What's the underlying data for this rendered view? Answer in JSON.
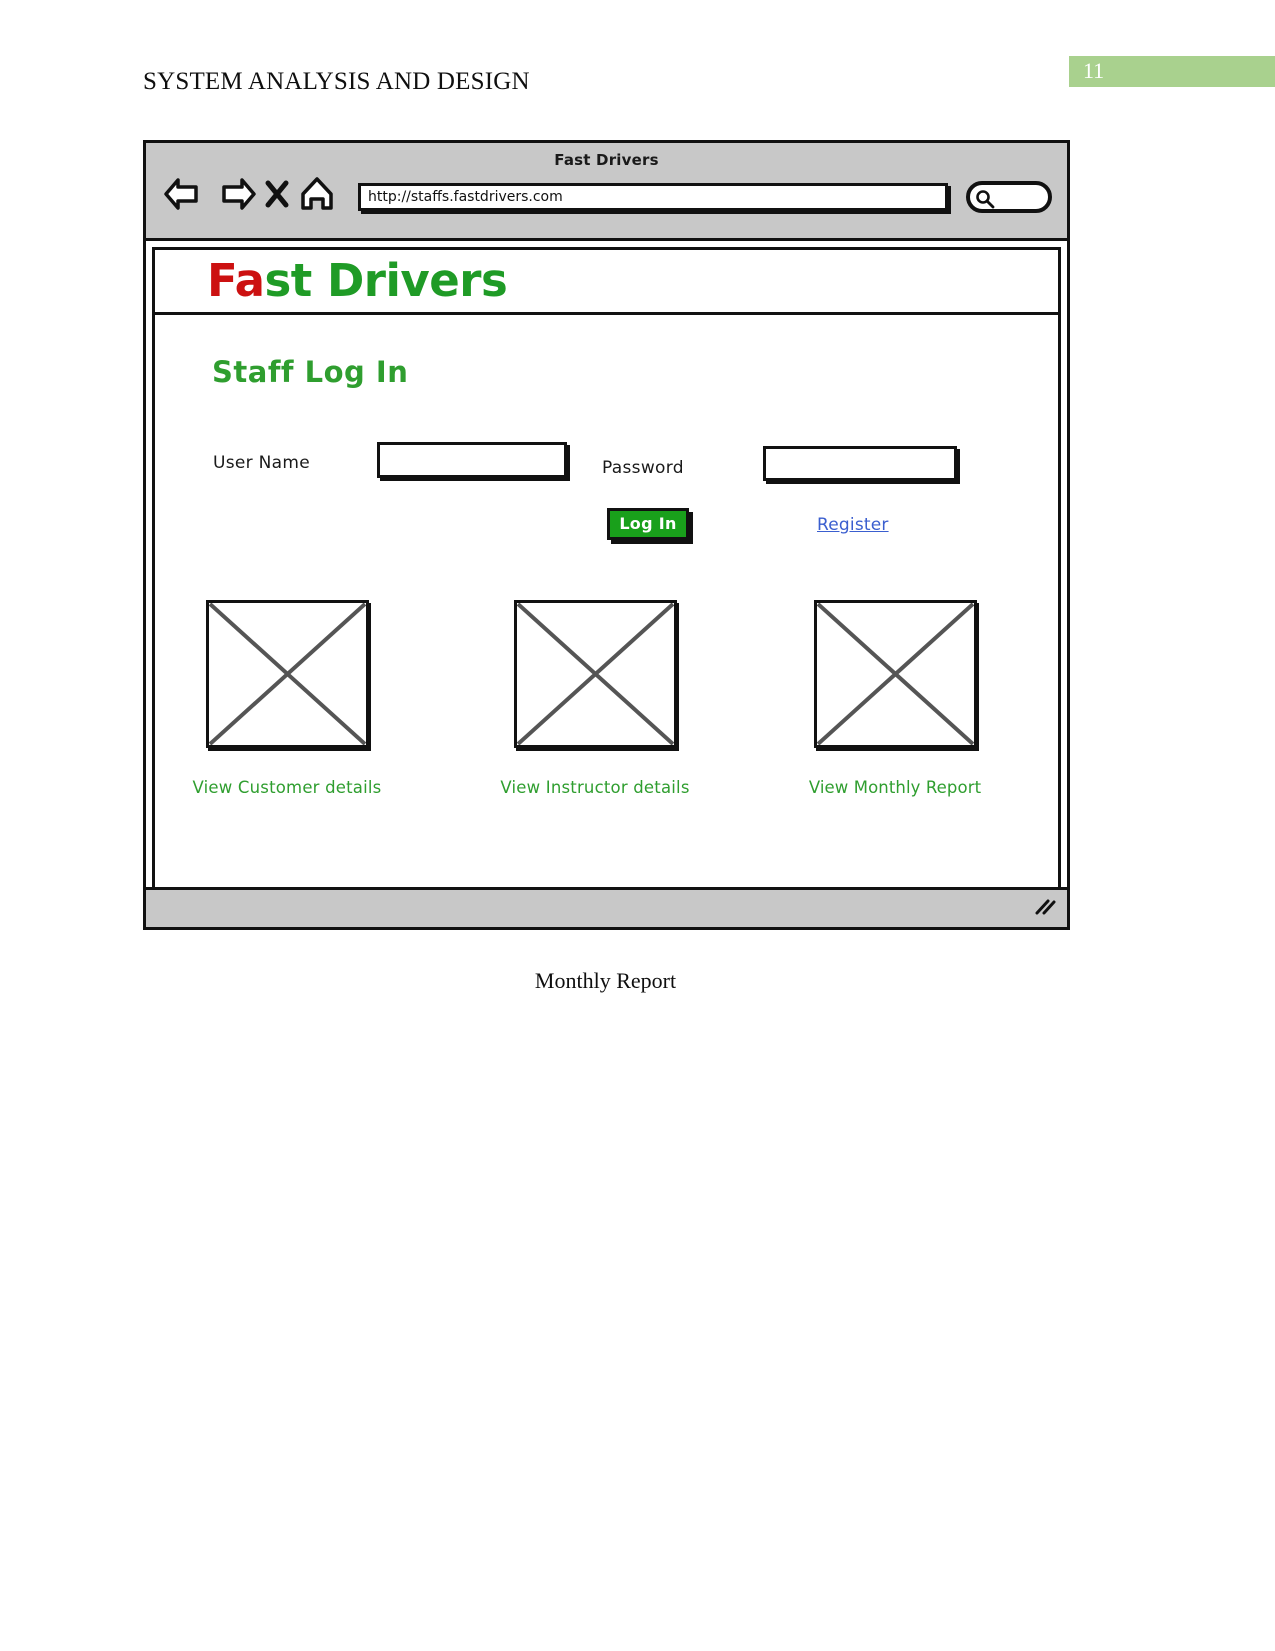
{
  "document": {
    "header_title": "SYSTEM ANALYSIS AND DESIGN",
    "page_number": "11",
    "page_badge_color": "#a9d18e",
    "figure_caption": "Monthly Report"
  },
  "browser": {
    "window_title": "Fast Drivers",
    "url": "http://staffs.fastdrivers.com",
    "search_placeholder": "",
    "search_value": "",
    "nav": {
      "back_label": "Back",
      "forward_label": "Forward",
      "stop_label": "Stop",
      "home_label": "Home"
    }
  },
  "site": {
    "logo_first": "Fa",
    "logo_rest": "st Drivers",
    "logo_color_first": "#cc1111",
    "logo_color_rest": "#1f9b26"
  },
  "login": {
    "heading": "Staff Log In",
    "heading_color": "#2f9e2f",
    "username_label": "User Name",
    "username_value": "",
    "username_placeholder": "",
    "password_label": "Password",
    "password_value": "",
    "password_placeholder": "",
    "login_button": "Log In",
    "login_button_color": "#19a01b",
    "register_link": "Register",
    "register_link_color": "#3a5ecf"
  },
  "tiles": [
    {
      "caption": "View Customer details",
      "image_alt": "placeholder-image"
    },
    {
      "caption": "View Instructor details",
      "image_alt": "placeholder-image"
    },
    {
      "caption": "View Monthly Report",
      "image_alt": "placeholder-image"
    }
  ]
}
